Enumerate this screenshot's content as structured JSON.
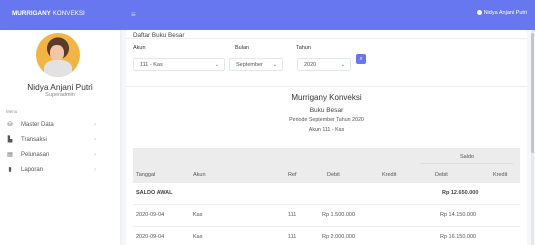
{
  "topbar": {
    "brand_bold": "MURRIGANY",
    "brand_rest": " KONVEKSI",
    "toggle_icon": "menu-icon",
    "user_name": "Nidya Anjani Putri"
  },
  "sidebar": {
    "user_name": "Nidya Anjani Putri",
    "user_role": "Superadmin",
    "menu_header": "Menu",
    "items": [
      {
        "label": "Master Data",
        "icon": "database-icon"
      },
      {
        "label": "Transaksi",
        "icon": "cart-icon"
      },
      {
        "label": "Pelunasan",
        "icon": "money-icon"
      },
      {
        "label": "Laporan",
        "icon": "file-icon"
      }
    ]
  },
  "page": {
    "title": "Daftar Buku Besar"
  },
  "filters": {
    "akun_label": "Akun",
    "akun_value": "111 - Kas",
    "bulan_label": "Bulan",
    "bulan_value": "September",
    "tahun_label": "Tahun",
    "tahun_value": "2020"
  },
  "report": {
    "company": "Murrigany Konveksi",
    "book": "Buku Besar",
    "period": "Periode September Tahun 2020",
    "account": "Akun 111 - Kas"
  },
  "table": {
    "headers": {
      "tanggal": "Tanggal",
      "akun": "Akun",
      "ref": "Ref",
      "debit": "Debit",
      "kredit": "Kredit",
      "saldo": "Saldo",
      "saldo_debit": "Debit",
      "saldo_kredit": "Kredit"
    },
    "saldo_awal": {
      "label": "SALDO AWAL",
      "saldo_debit": "Rp 12.650.000"
    },
    "rows": [
      {
        "tanggal": "2020-09-04",
        "akun": "Kas",
        "ref": "111",
        "debit": "Rp 1.500.000",
        "kredit": "",
        "saldo_debit": "Rp 14.150.000",
        "saldo_kredit": ""
      },
      {
        "tanggal": "2020-09-04",
        "akun": "Kas",
        "ref": "111",
        "debit": "Rp 2.000.000",
        "kredit": "",
        "saldo_debit": "Rp 16.150.000",
        "saldo_kredit": ""
      }
    ]
  }
}
